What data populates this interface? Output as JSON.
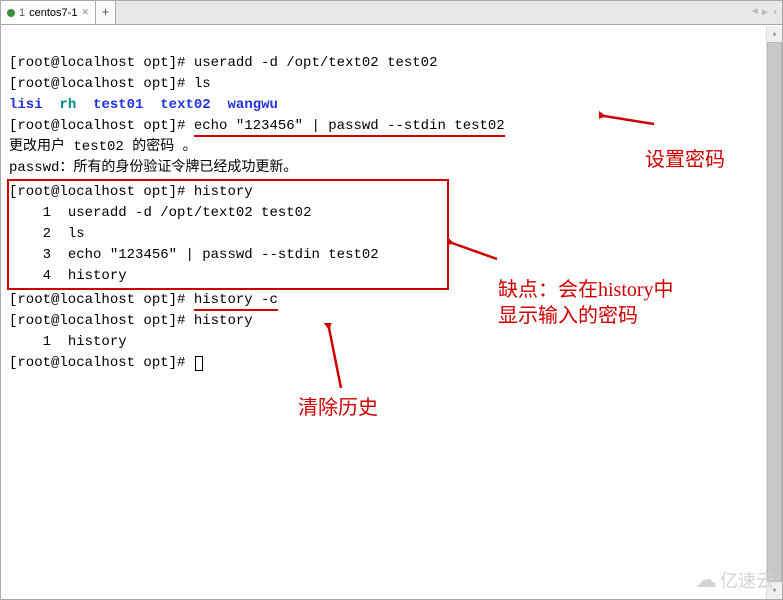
{
  "tab": {
    "number": "1",
    "title": "centos7-1",
    "add_label": "+",
    "close_glyph": "✕",
    "nav_left": "◄",
    "nav_right": "▶",
    "nav_menu": "▾"
  },
  "prompt": "[root@localhost opt]# ",
  "lines": {
    "l1_cmd": "useradd -d /opt/text02 test02",
    "l2_cmd": "ls",
    "l4_cmd": "echo \"123456\" | passwd --stdin test02",
    "l5": "更改用户 test02 的密码 。",
    "l6": "passwd：所有的身份验证令牌已经成功更新。",
    "l12_cmd": "history -c",
    "l13_cmd": "history"
  },
  "ls_output": {
    "lisi": "lisi",
    "rh": "rh",
    "test01": "test01",
    "text02": "text02",
    "wangwu": "wangwu"
  },
  "history_box": {
    "prompt_cmd": "history",
    "n1": "1",
    "c1": "useradd -d /opt/text02 test02",
    "n2": "2",
    "c2": "ls",
    "n3": "3",
    "c3": "echo \"123456\" | passwd --stdin test02",
    "n4": "4",
    "c4": "history"
  },
  "history_after": {
    "n1": "1",
    "c1": "history"
  },
  "annotations": {
    "set_password": "设置密码",
    "drawback_l1": "缺点：会在history中",
    "drawback_l2": "显示输入的密码",
    "clear_history": "清除历史"
  },
  "watermark": "亿速云",
  "scrollbar": {
    "up": "▴",
    "down": "▾"
  }
}
